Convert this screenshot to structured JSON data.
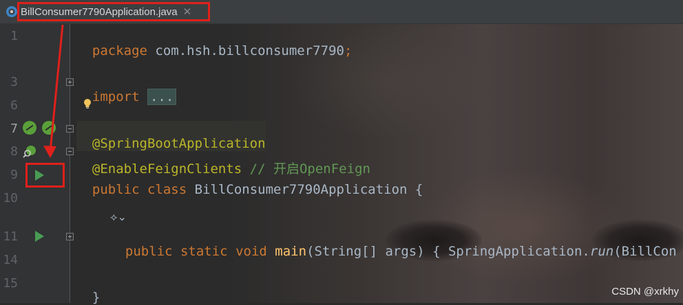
{
  "tab": {
    "filename": "BillConsumer7790Application.java",
    "close_glyph": "✕"
  },
  "gutter": {
    "line_numbers": [
      "1",
      "3",
      "6",
      "7",
      "8",
      "9",
      "10",
      "11",
      "14",
      "15"
    ]
  },
  "code": {
    "line1": {
      "keyword": "package",
      "rest": " com.hsh.billconsumer7790",
      "semi": ";"
    },
    "line3": {
      "keyword": "import",
      "dots": "..."
    },
    "line7": {
      "annotation": "@SpringBootApplication"
    },
    "line8": {
      "annotation": "@EnableFeignClients",
      "comment": " // 开启OpenFeign"
    },
    "line9": {
      "kw1": "public",
      "kw2": "class",
      "name": " BillConsumer7790Application {"
    },
    "line11": {
      "kw1": "public",
      "kw2": "static",
      "kw3": "void",
      "method": "main",
      "params": "(String[] args) { SpringApplication.",
      "static_call": "run",
      "tail": "(BillCon"
    },
    "line15": {
      "brace": "}"
    }
  },
  "hint": {
    "glyph": "⟡⌄"
  },
  "watermark": "CSDN @xrkhy",
  "colors": {
    "keyword": "#cc7832",
    "annotation": "#bbb529",
    "comment": "#629755",
    "method": "#ffc66d",
    "highlight_red": "#e0201b",
    "run_green": "#499c54"
  }
}
